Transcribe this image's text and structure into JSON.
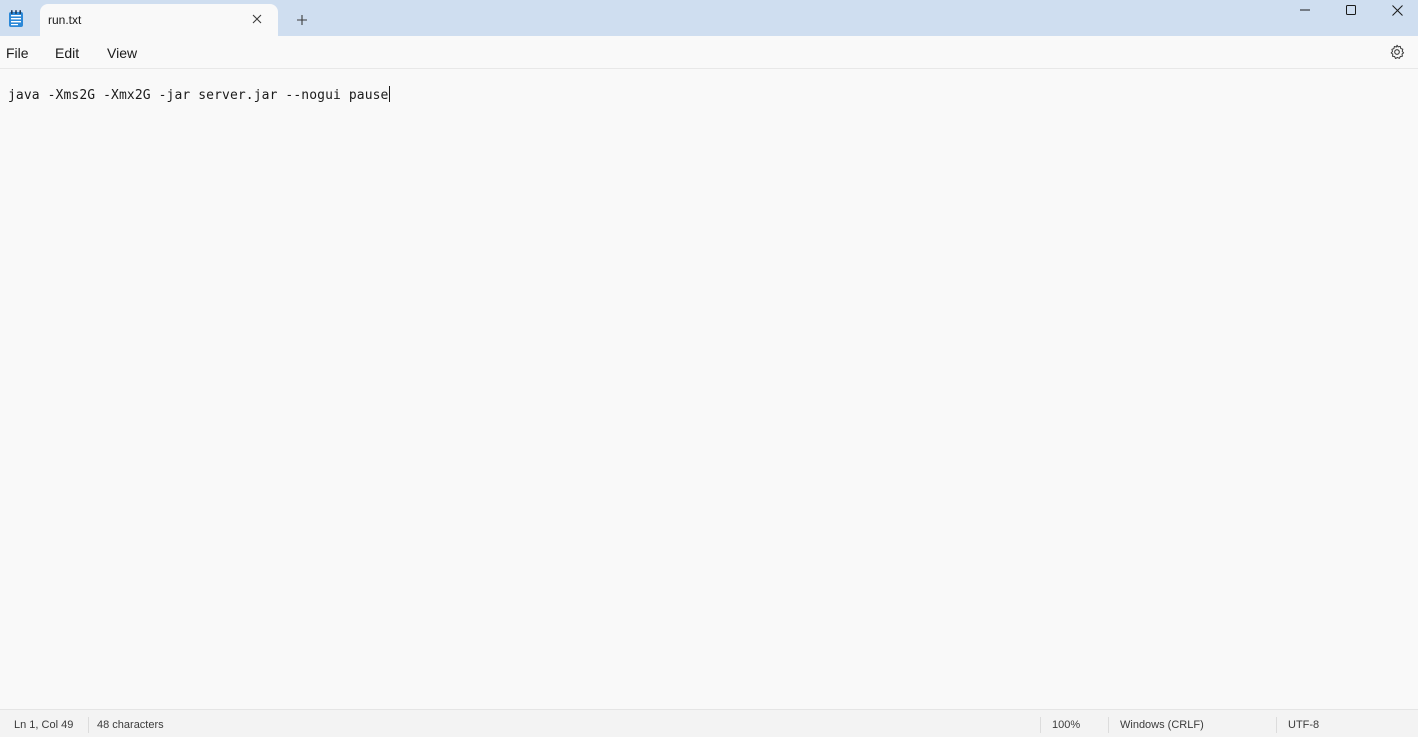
{
  "tab": {
    "title": "run.txt"
  },
  "menu": {
    "file": "File",
    "edit": "Edit",
    "view": "View"
  },
  "editor": {
    "content": "java -Xms2G -Xmx2G -jar server.jar --nogui pause"
  },
  "status": {
    "position": "Ln 1, Col 49",
    "characters": "48 characters",
    "zoom": "100%",
    "line_ending": "Windows (CRLF)",
    "encoding": "UTF-8"
  },
  "icons": {
    "app": "notepad-icon",
    "tab_close": "close-icon",
    "new_tab": "plus-icon",
    "minimize": "minimize-icon",
    "maximize": "maximize-icon",
    "close": "close-icon",
    "settings": "gear-icon"
  },
  "colors": {
    "titlebar": "#cfdef0",
    "background": "#f9f9f9",
    "accent": "#0067c0"
  }
}
